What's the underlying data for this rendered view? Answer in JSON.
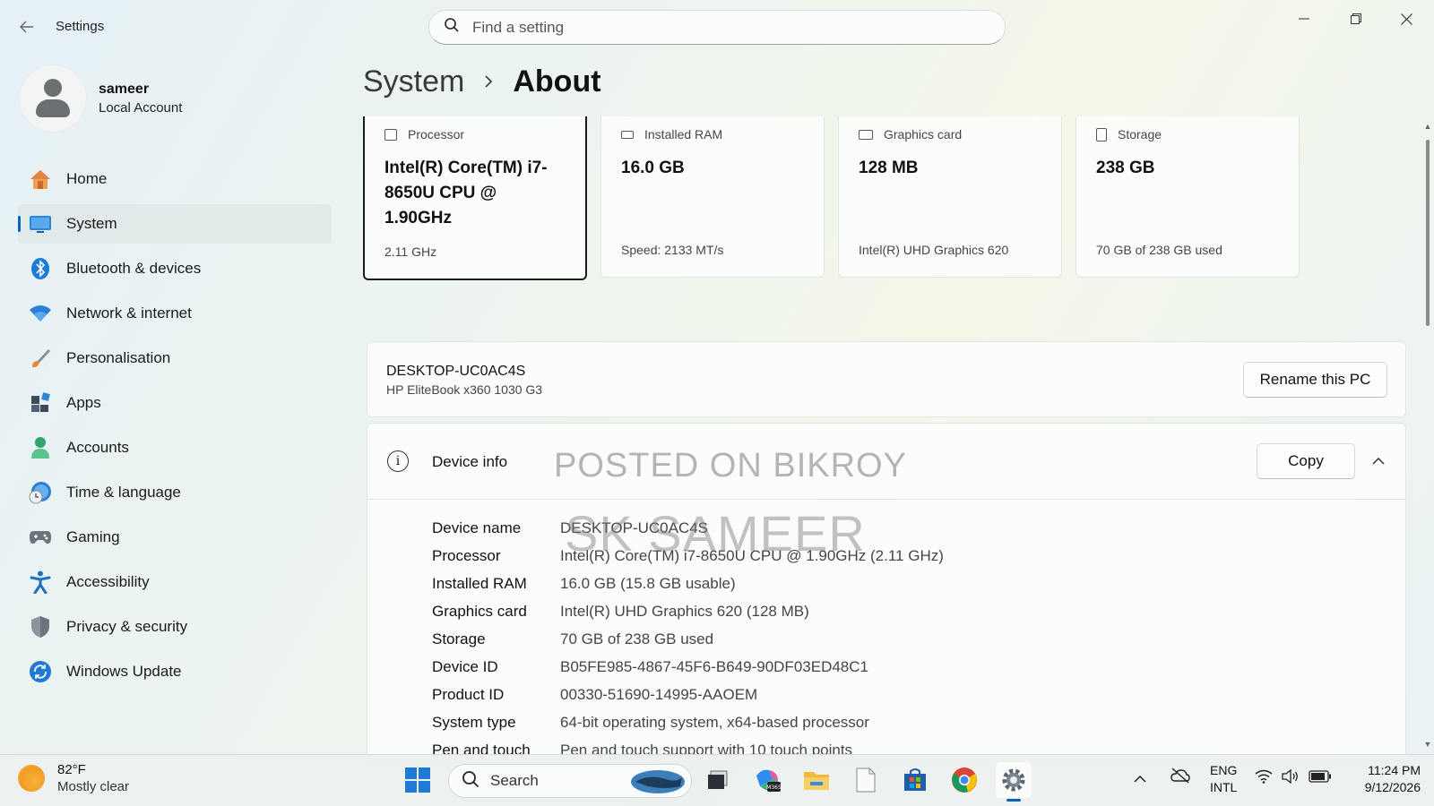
{
  "window": {
    "title": "Settings",
    "search_placeholder": "Find a setting"
  },
  "profile": {
    "name": "sameer",
    "account_type": "Local Account"
  },
  "nav": [
    {
      "label": "Home",
      "icon": "home-icon"
    },
    {
      "label": "System",
      "icon": "system-icon",
      "active": true
    },
    {
      "label": "Bluetooth & devices",
      "icon": "bluetooth-icon"
    },
    {
      "label": "Network & internet",
      "icon": "wifi-icon"
    },
    {
      "label": "Personalisation",
      "icon": "brush-icon"
    },
    {
      "label": "Apps",
      "icon": "apps-icon"
    },
    {
      "label": "Accounts",
      "icon": "accounts-icon"
    },
    {
      "label": "Time & language",
      "icon": "clock-globe-icon"
    },
    {
      "label": "Gaming",
      "icon": "gamepad-icon"
    },
    {
      "label": "Accessibility",
      "icon": "accessibility-icon"
    },
    {
      "label": "Privacy & security",
      "icon": "shield-icon"
    },
    {
      "label": "Windows Update",
      "icon": "update-icon"
    }
  ],
  "breadcrumb": {
    "parent": "System",
    "current": "About"
  },
  "spec_cards": [
    {
      "label": "Processor",
      "value": "Intel(R) Core(TM) i7-8650U CPU @ 1.90GHz",
      "sub": "2.11 GHz"
    },
    {
      "label": "Installed RAM",
      "value": "16.0 GB",
      "sub": "Speed: 2133 MT/s"
    },
    {
      "label": "Graphics card",
      "value": "128 MB",
      "sub": "Intel(R) UHD Graphics 620"
    },
    {
      "label": "Storage",
      "value": "238 GB",
      "sub": "70 GB of 238 GB used"
    }
  ],
  "pc": {
    "name": "DESKTOP-UC0AC4S",
    "model": "HP EliteBook x360 1030 G3",
    "rename_label": "Rename this PC"
  },
  "device_info": {
    "title": "Device info",
    "copy_label": "Copy",
    "watermark_line1": "POSTED ON BIKROY",
    "watermark_line2": "SK SAMEER",
    "rows": [
      {
        "key": "Device name",
        "value": "DESKTOP-UC0AC4S"
      },
      {
        "key": "Processor",
        "value": "Intel(R) Core(TM) i7-8650U CPU @ 1.90GHz (2.11 GHz)"
      },
      {
        "key": "Installed RAM",
        "value": "16.0 GB (15.8 GB usable)"
      },
      {
        "key": "Graphics card",
        "value": "Intel(R) UHD Graphics 620 (128 MB)"
      },
      {
        "key": "Storage",
        "value": "70 GB of 238 GB used"
      },
      {
        "key": "Device ID",
        "value": "B05FE985-4867-45F6-B649-90DF03ED48C1"
      },
      {
        "key": "Product ID",
        "value": "00330-51690-14995-AAOEM"
      },
      {
        "key": "System type",
        "value": "64-bit operating system, x64-based processor"
      },
      {
        "key": "Pen and touch",
        "value": "Pen and touch support with 10 touch points"
      }
    ]
  },
  "taskbar": {
    "weather_temp": "82°F",
    "weather_desc": "Mostly clear",
    "search_label": "Search",
    "lang_line1": "ENG",
    "lang_line2": "INTL",
    "time": "11:24 PM",
    "date": "9/12/2026"
  },
  "colors": {
    "accent": "#0067c0"
  }
}
